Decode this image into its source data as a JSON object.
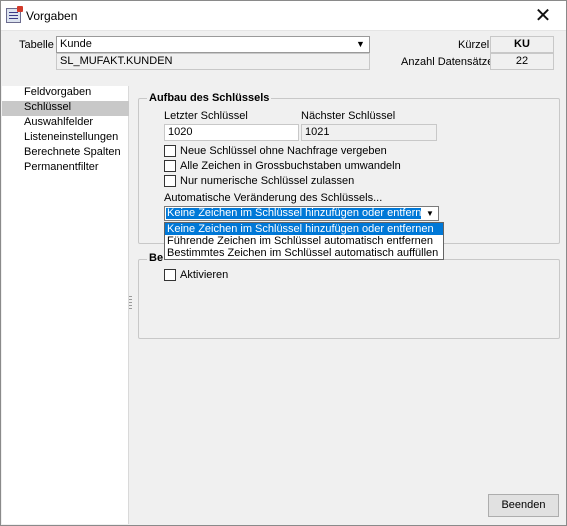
{
  "window": {
    "title": "Vorgaben",
    "close_glyph": "✕"
  },
  "header": {
    "tabelle_label": "Tabelle",
    "tabelle_value": "Kunde",
    "tabelle_name": "SL_MUFAKT.KUNDEN",
    "kuerzel_label": "Kürzel",
    "kuerzel_value": "KU",
    "anzahl_label": "Anzahl Datensätze",
    "anzahl_value": "22"
  },
  "sidebar": {
    "items": [
      {
        "label": "Feldvorgaben",
        "selected": false
      },
      {
        "label": "Schlüssel",
        "selected": true
      },
      {
        "label": "Auswahlfelder",
        "selected": false
      },
      {
        "label": "Listeneinstellungen",
        "selected": false
      },
      {
        "label": "Berechnete Spalten",
        "selected": false
      },
      {
        "label": "Permanentfilter",
        "selected": false
      }
    ]
  },
  "key_group": {
    "title": "Aufbau des Schlüssels",
    "last_key_label": "Letzter Schlüssel",
    "last_key_value": "1020",
    "next_key_label": "Nächster Schlüssel",
    "next_key_value": "1021",
    "checkboxes": [
      {
        "label": "Neue Schlüssel ohne Nachfrage vergeben",
        "checked": false
      },
      {
        "label": "Alle Zeichen in Grossbuchstaben umwandeln",
        "checked": false
      },
      {
        "label": "Nur numerische Schlüssel zulassen",
        "checked": false
      }
    ],
    "auto_label": "Automatische Veränderung des Schlüssels...",
    "auto_selected": "Keine Zeichen im Schlüssel hinzufügen oder entfernen",
    "auto_options": [
      "Keine Zeichen im Schlüssel hinzufügen oder entfernen",
      "Führende Zeichen im Schlüssel automatisch entfernen",
      "Bestimmtes Zeichen im Schlüssel automatisch auffüllen"
    ]
  },
  "second_group": {
    "title_visible": "Be",
    "activate_label": "Aktivieren",
    "activate_checked": false
  },
  "footer": {
    "close_button": "Beenden"
  },
  "colors": {
    "selection": "#0078d7",
    "nav_selected": "#c8c8c8",
    "window_bg": "#f0f0f0"
  },
  "icons": {
    "app": "form-icon",
    "close": "close-icon",
    "dropdown": "chevron-down-icon"
  }
}
